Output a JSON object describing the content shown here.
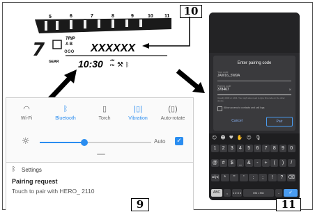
{
  "callouts": {
    "c10": "10",
    "c11": "11",
    "c9": "9"
  },
  "dashboard": {
    "rpm_ticks": [
      "5",
      "6",
      "7",
      "8",
      "9",
      "10",
      "11"
    ],
    "trip_label": "TRIP",
    "trip_ab": "A B",
    "odometer_value": "XXXXXX",
    "gear_label": "GEAR",
    "clock": "10:30",
    "am": "AM",
    "pm": "PM"
  },
  "quick_settings": {
    "tiles": [
      {
        "label": "Wi-Fi",
        "icon": "wifi-icon",
        "active": false
      },
      {
        "label": "Bluetooth",
        "icon": "bluetooth-icon",
        "active": true
      },
      {
        "label": "Torch",
        "icon": "torch-icon",
        "active": false
      },
      {
        "label": "Vibration",
        "icon": "vibration-icon",
        "active": true
      },
      {
        "label": "Auto-rotate",
        "icon": "auto-rotate-icon",
        "active": false
      }
    ],
    "brightness_level": 0.4,
    "auto_label": "Auto",
    "auto_checked": true
  },
  "notification": {
    "app": "Settings",
    "title": "Pairing request",
    "body": "Touch to pair with HERO_ 2110"
  },
  "pairing_dialog": {
    "title": "Enter pairing code",
    "name_label": "Your code",
    "name_value": "JAW16_5W9A",
    "code_label": "Pairing code",
    "code_value": "378467",
    "helper": "Usually 0000 or 1234. You might also need to type this code on the other device.",
    "checkbox_label": "Allow access to contacts and call logs",
    "cancel": "Cancel",
    "pair": "Pair"
  },
  "keyboard": {
    "number_row": [
      "1",
      "2",
      "3",
      "4",
      "5",
      "6",
      "7",
      "8",
      "9",
      "0"
    ],
    "symbol_row1": [
      "@",
      "#",
      "$",
      "_",
      "&",
      "-",
      "+",
      "(",
      ")",
      "/"
    ],
    "symbol_row2": [
      "=\\<",
      "*",
      "\"",
      "'",
      ":",
      ";",
      "!",
      "?",
      "⌫"
    ],
    "bottom": {
      "abc": "ABC",
      "comma": ",",
      "nums": "1 2 3 4",
      "lang": "EN • HG",
      "period": "."
    }
  },
  "colors": {
    "accent": "#2a8df0",
    "lcd_dark": "#1a1a1a",
    "phone_bg": "#2b2b2e",
    "key_bg": "#3b3b3e",
    "check_blue": "#2a8df0"
  }
}
